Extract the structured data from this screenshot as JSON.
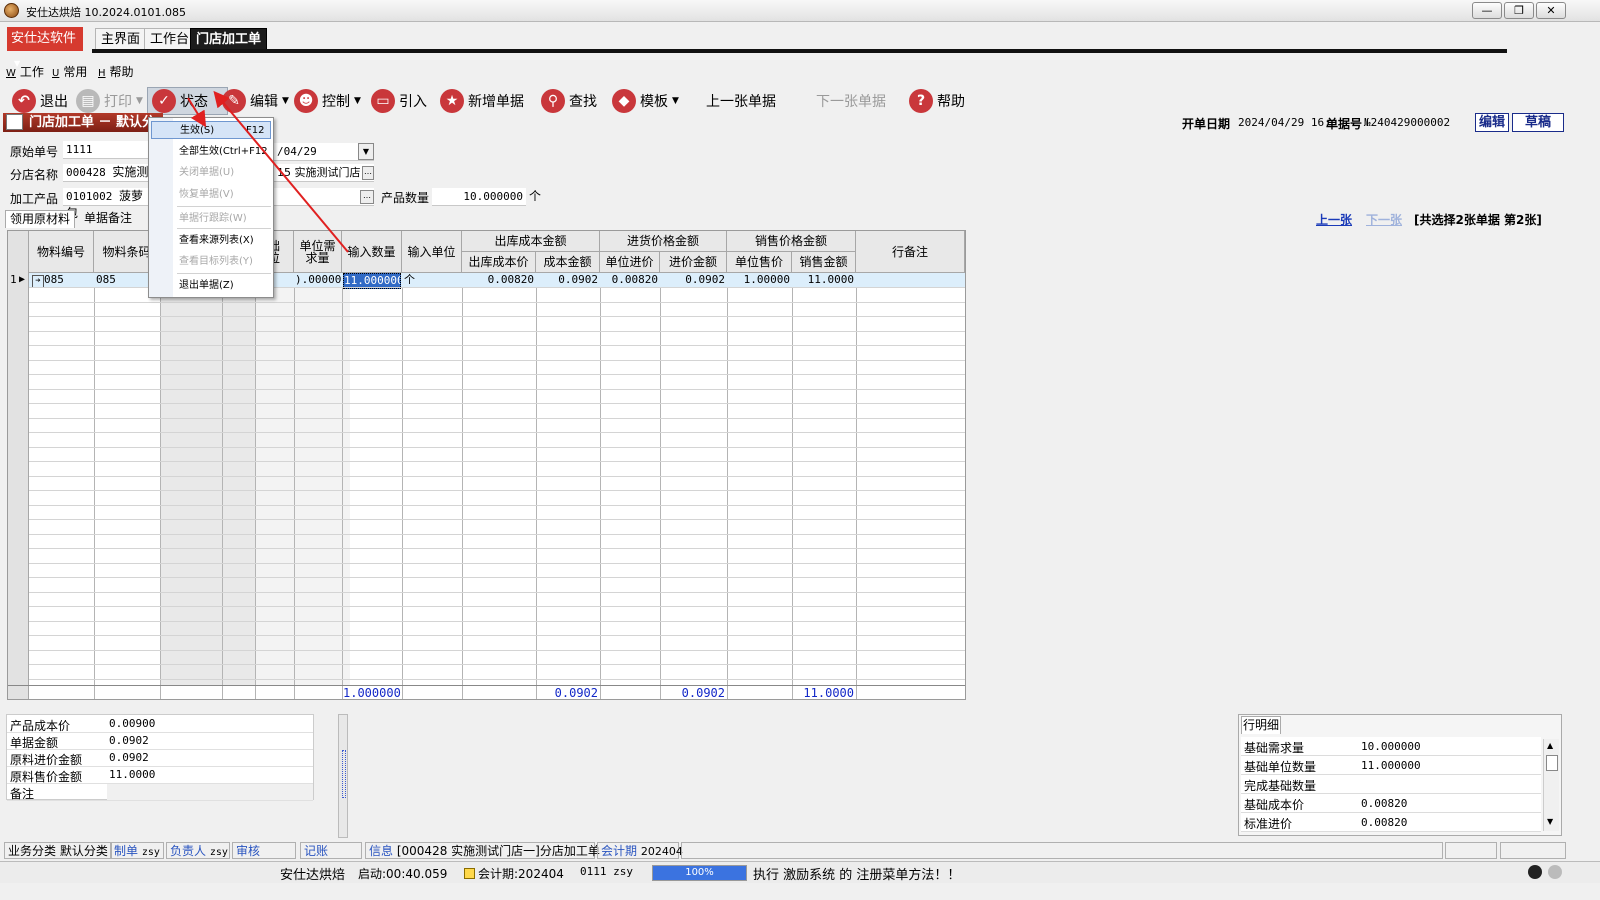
{
  "window": {
    "title": "安仕达烘焙   10.2024.0101.085",
    "min": "—",
    "max": "❐",
    "close": "✕"
  },
  "brand": "安仕达软件",
  "top_tabs": [
    "主界面",
    "工作台",
    "门店加工单"
  ],
  "menubar": [
    {
      "key": "W",
      "label": "工作"
    },
    {
      "key": "U",
      "label": "常用"
    },
    {
      "key": "H",
      "label": "帮助"
    }
  ],
  "toolbar": {
    "exit": "退出",
    "print": "打印",
    "state": "状态",
    "edit": "编辑",
    "control": "控制",
    "import": "引入",
    "new": "新增单据",
    "find": "查找",
    "template": "模板",
    "prev": "上一张单据",
    "next": "下一张单据",
    "help": "帮助"
  },
  "form": {
    "title": "门店加工单 － 默认分",
    "open_date_label": "开单日期",
    "open_date": "2024/04/29 16:",
    "doc_no_label": "单据号",
    "doc_no": "№240429000002",
    "edit_btn": "编辑",
    "draft_btn": "草稿",
    "orig_no_label": "原始单号",
    "orig_no": "1111",
    "branch_label": "分店名称",
    "branch_code": "000428",
    "branch_name": "实施测",
    "date_partial": "/04/29",
    "store_partial": "15  实施测试门店",
    "product_label": "加工产品",
    "product_code": "0101002",
    "product_name": "菠萝包",
    "qty_label": "产品数量",
    "qty": "10.000000",
    "qty_unit": "个"
  },
  "subtabs": [
    "领用原材料",
    "单据备注"
  ],
  "doc_nav": {
    "prev": "上一张",
    "next": "下一张",
    "info": "[共选择2张单据   第2张]"
  },
  "grid": {
    "headers": {
      "material_no": "物料编号",
      "barcode": "物料条码",
      "base_unit": "础\n位",
      "unit_req": "单位需\n求量",
      "input_qty": "输入数量",
      "input_unit": "输入单位",
      "out_group": "出库成本金额",
      "out_price": "出库成本价",
      "out_amount": "成本金额",
      "purchase_group": "进货价格金额",
      "unit_purchase": "单位进价",
      "purchase_amount": "进价金额",
      "sale_group": "销售价格金额",
      "unit_sale": "单位售价",
      "sale_amount": "销售金额",
      "remark": "行备注"
    },
    "row": {
      "index": "1",
      "material_no": "085",
      "barcode": "085",
      "unit_req": ").000000",
      "input_qty": "11.000000",
      "input_unit": "个",
      "out_price": "0.00820",
      "out_amount": "0.0902",
      "unit_purchase": "0.00820",
      "purchase_amount": "0.0902",
      "unit_sale": "1.00000",
      "sale_amount": "11.0000"
    },
    "totals": {
      "input_qty": "1.000000",
      "out_amount": "0.0902",
      "purchase_amount": "0.0902",
      "sale_amount": "11.0000"
    }
  },
  "state_menu": [
    {
      "label": "生效(S)",
      "shortcut": "F12",
      "state": "selected"
    },
    {
      "label": "全部生效(C",
      "shortcut": "trl+F12",
      "state": "enabled"
    },
    {
      "label": "关闭单据(U)",
      "state": "disabled"
    },
    {
      "label": "恢复单据(V)",
      "state": "disabled"
    },
    {
      "label": "单据行跟踪(W)",
      "state": "disabled"
    },
    {
      "label": "查看来源列表(X)",
      "state": "enabled"
    },
    {
      "label": "查看目标列表(Y)",
      "state": "disabled"
    },
    {
      "label": "退出单据(Z)",
      "state": "enabled"
    }
  ],
  "summary": [
    {
      "label": "产品成本价",
      "value": "0.00900"
    },
    {
      "label": "单据金额",
      "value": "0.0902"
    },
    {
      "label": "原料进价金额",
      "value": "0.0902"
    },
    {
      "label": "原料售价金额",
      "value": "11.0000"
    },
    {
      "label": "备注",
      "value": ""
    }
  ],
  "detail": {
    "tab": "行明细",
    "rows": [
      {
        "label": "基础需求量",
        "value": "10.000000"
      },
      {
        "label": "基础单位数量",
        "value": "11.000000"
      },
      {
        "label": "完成基础数量",
        "value": ""
      },
      {
        "label": "基础成本价",
        "value": "0.00820"
      },
      {
        "label": "标准进价",
        "value": "0.00820"
      }
    ]
  },
  "statusbar": {
    "biz": "业务分类 默认分类",
    "maker_k": "制单",
    "maker_v": "zsy",
    "owner_k": "负责人",
    "owner_v": "zsy",
    "audit_k": "审核",
    "book_k": "记账",
    "info_k": "信息",
    "info_v": "[000428 实施测试门店一]分店加工单",
    "period_k": "会计期",
    "period_v": "202404"
  },
  "bottombar": {
    "app": "安仕达烘焙",
    "uptime": "启动:00:40.059",
    "period": "会计期:202404",
    "user": "0111  zsy",
    "progress": "100%",
    "progress_fraction": 1.0,
    "message": "执行  激励系统  的  注册菜单方法！！"
  },
  "colors": {
    "brand": "#d63a2f",
    "accent_blue": "#1227c8",
    "selected_row": "#dceefb",
    "menu_highlight": "#d5e4f7",
    "arrow": "#e02020"
  }
}
